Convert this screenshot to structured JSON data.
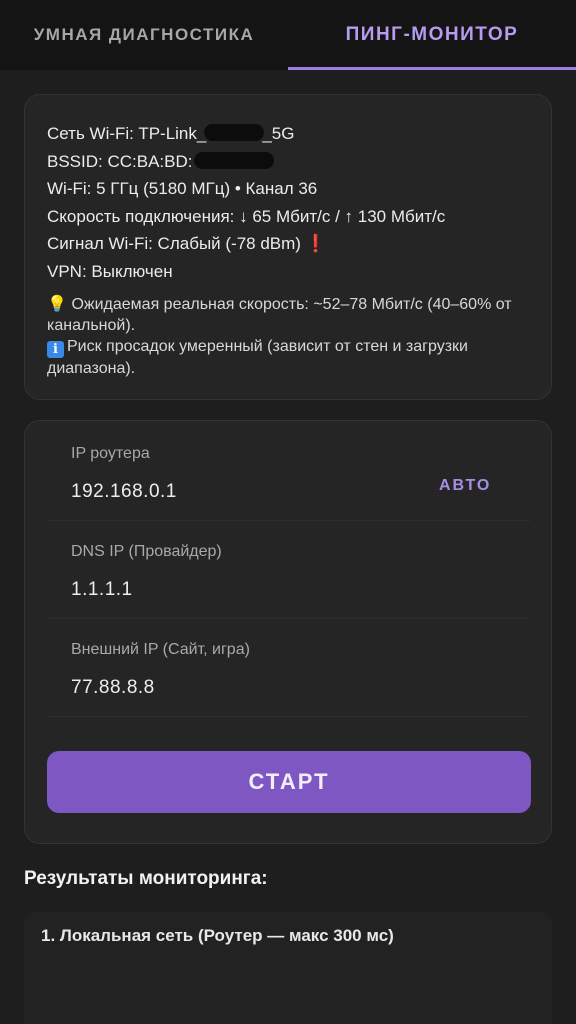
{
  "tabs": [
    {
      "label": "УМНАЯ ДИАГНОСТИКА",
      "active": false
    },
    {
      "label": "ПИНГ-МОНИТОР",
      "active": true
    }
  ],
  "info": {
    "wifi_prefix": "Сеть Wi-Fi: TP-Link_",
    "wifi_suffix": "_5G",
    "bssid_prefix": "BSSID: CC:BA:BD:",
    "band": "Wi-Fi: 5 ГГц (5180 МГц) • Канал 36",
    "speed": "Скорость подключения: ↓ 65 Мбит/с / ↑ 130 Мбит/с",
    "signal": "Сигнал Wi-Fi: Слабый (-78 dBm)",
    "signal_mark": "❗",
    "vpn": "VPN: Выключен",
    "tip1_icon": "💡",
    "tip1": "Ожидаемая реальная скорость: ~52–78 Мбит/с (40–60% от канальной).",
    "tip2_icon": "i",
    "tip2": "Риск просадок умеренный (зависит от стен и загрузки диапазона)."
  },
  "ip": {
    "router_label": "IP роутера",
    "router_value": "192.168.0.1",
    "auto_label": "АВТО",
    "dns_label": "DNS IP (Провайдер)",
    "dns_value": "1.1.1.1",
    "external_label": "Внешний IP (Сайт, игра)",
    "external_value": "77.88.8.8",
    "start_label": "СТАРТ"
  },
  "results": {
    "title": "Результаты мониторинга:",
    "items": [
      "1. Локальная сеть (Роутер — макс 300 мс)"
    ]
  },
  "colors": {
    "accent": "#7e57c2",
    "accent_text": "#b59cf0",
    "background": "#1e1e1e",
    "card": "#252525"
  }
}
